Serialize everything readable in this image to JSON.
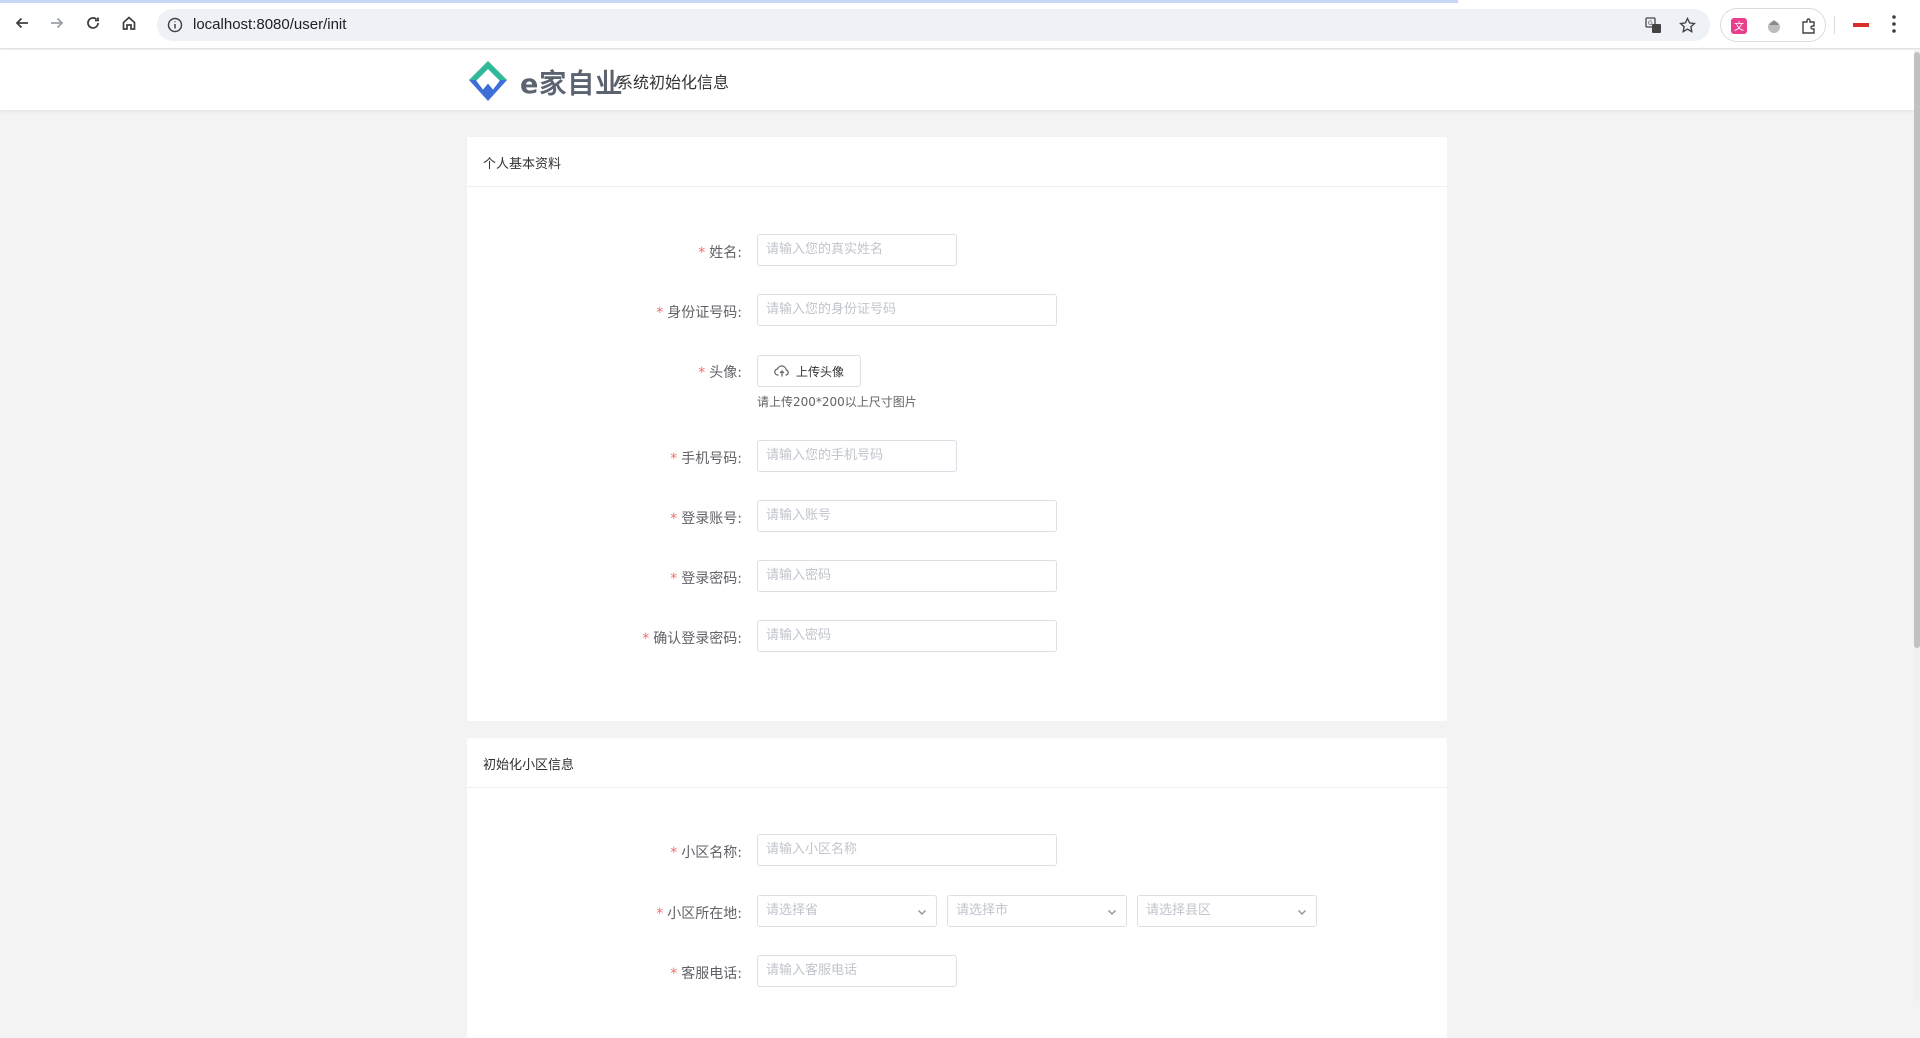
{
  "browser": {
    "url": "localhost:8080/user/init",
    "icons": [
      "back-icon",
      "forward-icon",
      "reload-icon",
      "home-icon",
      "site-info-icon",
      "translate-icon",
      "bookmark-star-icon",
      "extension-icon",
      "puzzle-icon",
      "menu-icon"
    ]
  },
  "header": {
    "logo_text": "e家自业",
    "subtitle": "系统初始化信息",
    "colors": {
      "logo_green": "#2fb89a",
      "logo_blue": "#3d6fd8"
    }
  },
  "personal": {
    "title": "个人基本资料",
    "required_mark": "*",
    "name": {
      "label": "姓名:",
      "placeholder": "请输入您的真实姓名"
    },
    "id_card": {
      "label": "身份证号码:",
      "placeholder": "请输入您的身份证号码"
    },
    "avatar": {
      "label": "头像:",
      "button": "上传头像",
      "tip": "请上传200*200以上尺寸图片"
    },
    "phone": {
      "label": "手机号码:",
      "placeholder": "请输入您的手机号码"
    },
    "account": {
      "label": "登录账号:",
      "placeholder": "请输入账号"
    },
    "password": {
      "label": "登录密码:",
      "placeholder": "请输入密码"
    },
    "confirm_password": {
      "label": "确认登录密码:",
      "placeholder": "请输入密码"
    }
  },
  "community": {
    "title": "初始化小区信息",
    "name": {
      "label": "小区名称:",
      "placeholder": "请输入小区名称"
    },
    "location": {
      "label": "小区所在地:",
      "province": "请选择省",
      "city": "请选择市",
      "district": "请选择县区"
    },
    "service_phone": {
      "label": "客服电话:",
      "placeholder": "请输入客服电话"
    }
  },
  "colors": {
    "required": "#f56c6c",
    "border": "#dcdfe6",
    "placeholder": "#c0c4cc",
    "page_bg": "#f3f3f3"
  }
}
